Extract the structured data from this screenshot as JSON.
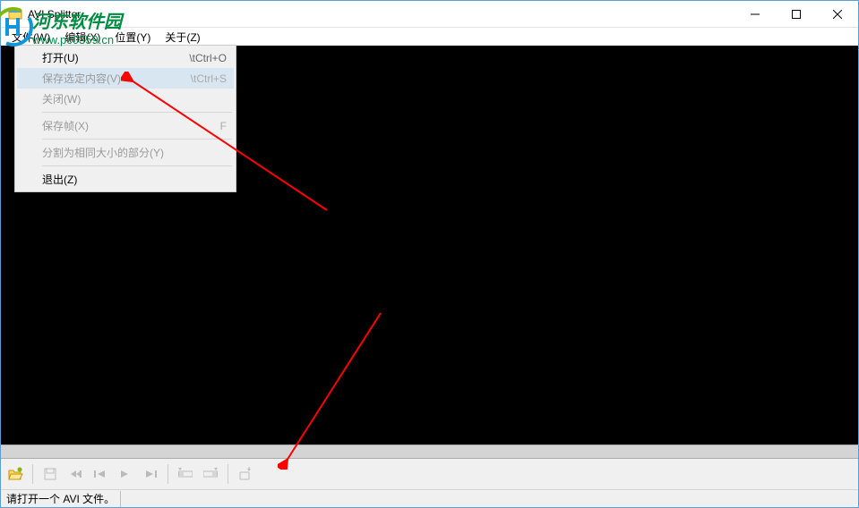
{
  "window": {
    "title": "AVI Splitter"
  },
  "menubar": {
    "items": [
      {
        "label": "文件(W)"
      },
      {
        "label": "编辑(X)"
      },
      {
        "label": "位置(Y)"
      },
      {
        "label": "关于(Z)"
      }
    ]
  },
  "dropdown": {
    "items": [
      {
        "label": "打开(U)",
        "shortcut": "\\tCtrl+O",
        "disabled": false
      },
      {
        "label": "保存选定内容(V)",
        "shortcut": "\\tCtrl+S",
        "disabled": true,
        "highlighted": true
      },
      {
        "label": "关闭(W)",
        "shortcut": "",
        "disabled": true
      },
      {
        "type": "separator"
      },
      {
        "label": "保存帧(X)",
        "shortcut": "F",
        "disabled": true
      },
      {
        "type": "separator"
      },
      {
        "label": "分割为相同大小的部分(Y)",
        "shortcut": "",
        "disabled": true
      },
      {
        "type": "separator"
      },
      {
        "label": "退出(Z)",
        "shortcut": "",
        "disabled": false
      }
    ]
  },
  "toolbar": {
    "open": "open",
    "save": "save",
    "prev_fast": "prev-fast",
    "prev": "prev",
    "next": "next",
    "next_fast": "next-fast",
    "mark_start": "mark-start",
    "mark_end": "mark-end",
    "split": "split"
  },
  "statusbar": {
    "message": "请打开一个 AVI 文件。"
  },
  "watermark": {
    "title": "河东软件园",
    "url": "www.pc0359.cn"
  }
}
